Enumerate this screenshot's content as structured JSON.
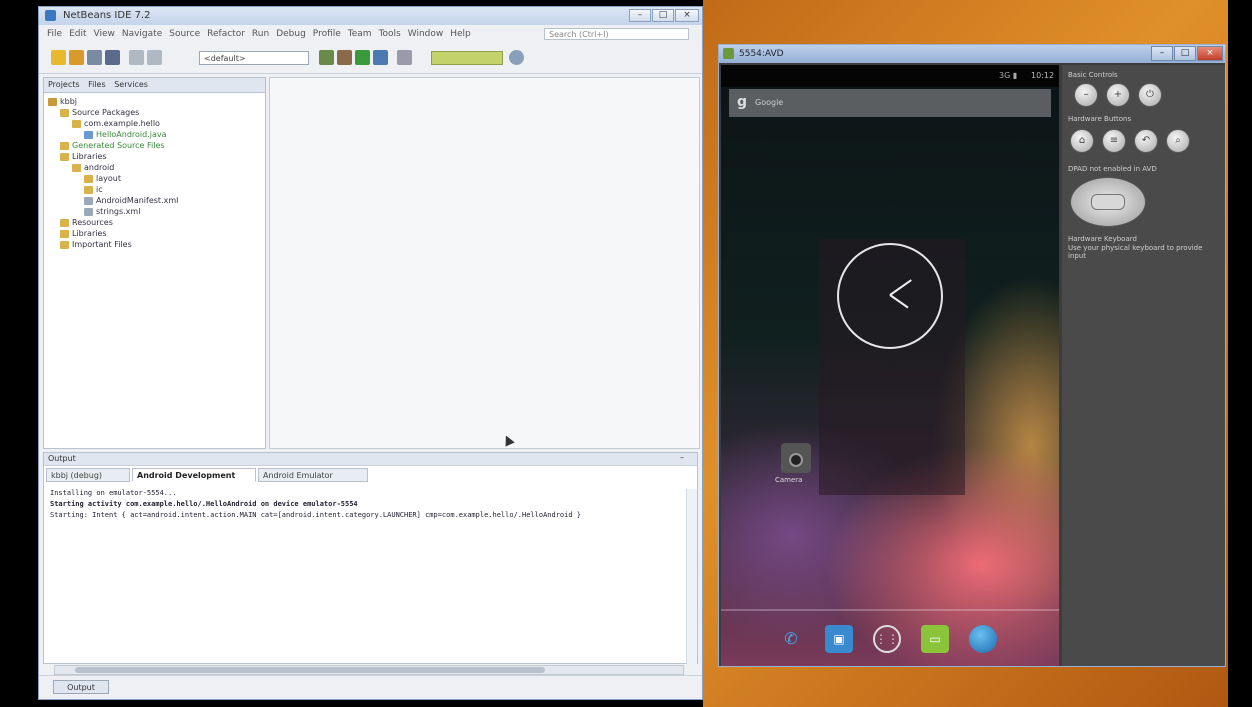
{
  "ide": {
    "title": "NetBeans IDE 7.2",
    "menus": [
      "File",
      "Edit",
      "View",
      "Navigate",
      "Source",
      "Refactor",
      "Run",
      "Debug",
      "Profile",
      "Team",
      "Tools",
      "Window",
      "Help"
    ],
    "search_placeholder": "Search (Ctrl+I)",
    "config": "<default>",
    "memory": "",
    "project_tabs": [
      "Projects",
      "Files",
      "Services"
    ],
    "tree": [
      {
        "label": "kbbj",
        "depth": 0
      },
      {
        "label": "Source Packages",
        "depth": 1
      },
      {
        "label": "com.example.hello",
        "depth": 2
      },
      {
        "label": "HelloAndroid.java",
        "depth": 3
      },
      {
        "label": "Generated Source Files",
        "depth": 1
      },
      {
        "label": "Libraries",
        "depth": 1
      },
      {
        "label": "android",
        "depth": 2
      },
      {
        "label": "layout",
        "depth": 3
      },
      {
        "label": "ic",
        "depth": 3
      },
      {
        "label": "AndroidManifest.xml",
        "depth": 3
      },
      {
        "label": "strings.xml",
        "depth": 3
      },
      {
        "label": "Resources",
        "depth": 1
      },
      {
        "label": "Libraries",
        "depth": 1
      },
      {
        "label": "Important Files",
        "depth": 1
      }
    ],
    "output": {
      "title": "Output",
      "tabs": [
        "kbbj (debug)",
        "Android Development",
        "Android Emulator"
      ],
      "lines": [
        "Installing on emulator-5554...",
        "Starting activity com.example.hello/.HelloAndroid on device emulator-5554",
        "Starting: Intent { act=android.intent.action.MAIN cat=[android.intent.category.LAUNCHER] cmp=com.example.hello/.HelloAndroid }"
      ]
    },
    "status_button": "Output"
  },
  "emulator": {
    "title": "5554:AVD",
    "statusbar_time": "10:12",
    "statusbar_icons": "3G ▮",
    "search_text": "Google",
    "app_label": "Camera",
    "dock_icons": [
      "phone-icon",
      "contacts-icon",
      "all-apps-icon",
      "messaging-icon",
      "browser-icon"
    ],
    "controls": {
      "basic_label": "Basic Controls",
      "hardware_label": "Hardware Buttons",
      "dpad_label": "DPAD not enabled in AVD",
      "keyboard_label": "Hardware Keyboard",
      "keyboard_hint": "Use your physical keyboard to provide input"
    }
  },
  "colors": {
    "ide_bg": "#eef0f3",
    "desktop_orange": "#e0902a",
    "emu_panel": "#4a4a4a",
    "memory_bar": "#c3d26a"
  }
}
